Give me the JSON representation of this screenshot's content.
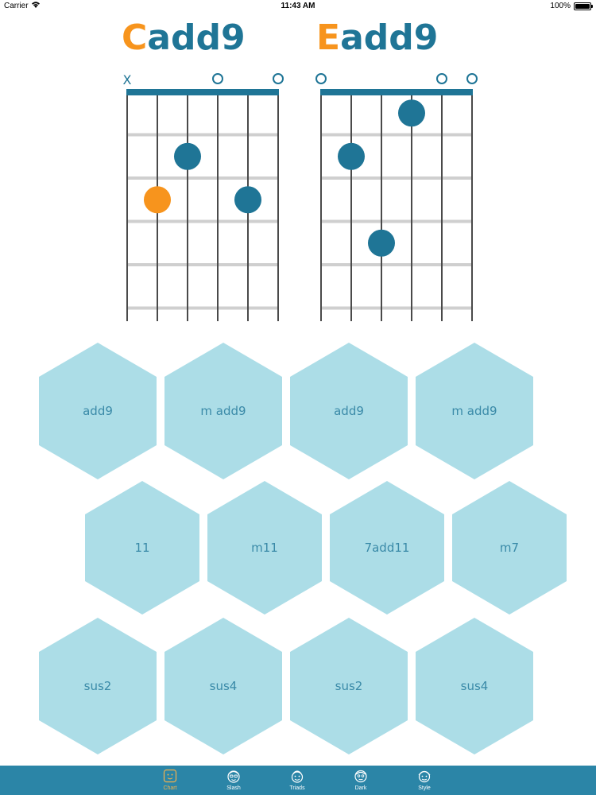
{
  "status_bar": {
    "carrier": "Carrier",
    "time": "11:43 AM",
    "battery": "100%"
  },
  "chords": [
    {
      "root": "C",
      "quality": "add9",
      "string_markers": [
        "X",
        "",
        "",
        "O",
        "",
        "O"
      ],
      "dots": [
        {
          "string": 3,
          "fret": 2,
          "color": "#1f7596"
        },
        {
          "string": 2,
          "fret": 3,
          "color": "#f7941d"
        },
        {
          "string": 5,
          "fret": 3,
          "color": "#1f7596"
        }
      ]
    },
    {
      "root": "E",
      "quality": "add9",
      "string_markers": [
        "O",
        "",
        "",
        "",
        "O",
        "O"
      ],
      "dots": [
        {
          "string": 4,
          "fret": 1,
          "color": "#1f7596"
        },
        {
          "string": 2,
          "fret": 2,
          "color": "#1f7596"
        },
        {
          "string": 3,
          "fret": 4,
          "color": "#1f7596"
        }
      ]
    }
  ],
  "variations": {
    "row1": [
      "add9",
      "m add9",
      "add9",
      "m add9"
    ],
    "row2": [
      "11",
      "m11",
      "7add11",
      "m7"
    ],
    "row3": [
      "sus2",
      "sus4",
      "sus2",
      "sus4"
    ]
  },
  "tabs": [
    {
      "label": "Chart",
      "icon": "chart-face-icon",
      "active": true
    },
    {
      "label": "Slash",
      "icon": "slash-face-icon",
      "active": false
    },
    {
      "label": "Triads",
      "icon": "triads-face-icon",
      "active": false
    },
    {
      "label": "Dark",
      "icon": "dark-face-icon",
      "active": false
    },
    {
      "label": "Style",
      "icon": "style-face-icon",
      "active": false
    }
  ],
  "colors": {
    "accent": "#f7941d",
    "primary": "#1f7596",
    "hex_fill": "#acdde7",
    "hex_text": "#3a8aa8",
    "tab_bar": "#2b85a7"
  }
}
